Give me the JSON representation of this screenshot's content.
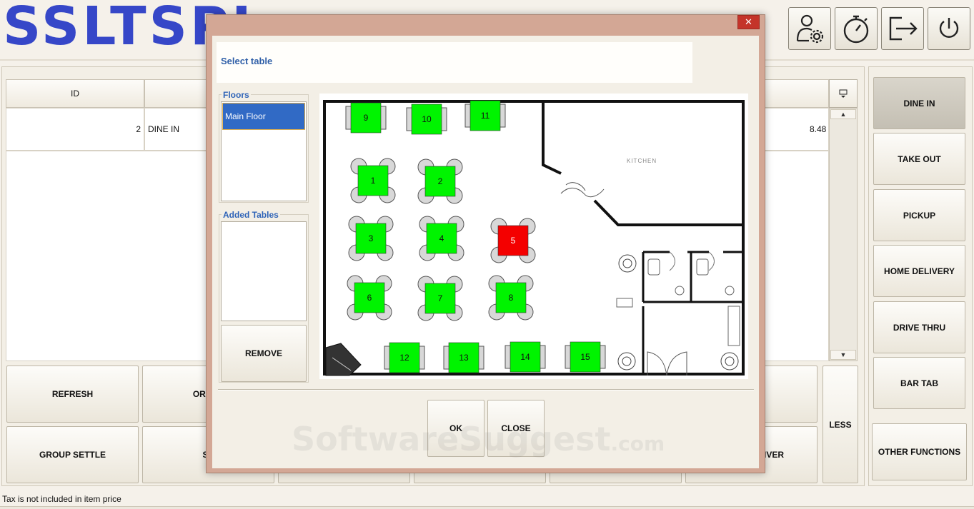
{
  "header": {
    "logo_text": "SSLTSPI",
    "buttons": [
      {
        "name": "user-settings-button",
        "icon": "user-gear-icon"
      },
      {
        "name": "timer-button",
        "icon": "stopwatch-icon"
      },
      {
        "name": "logout-button",
        "icon": "exit-arrow-icon"
      },
      {
        "name": "power-button",
        "icon": "power-icon"
      }
    ]
  },
  "grid": {
    "headers": [
      "ID"
    ],
    "rows": [
      {
        "id": "2",
        "type": "DINE IN",
        "amount": "8.48"
      }
    ]
  },
  "bottom_buttons": {
    "row1": [
      "REFRESH",
      "ORDER"
    ],
    "row2": [
      "GROUP SETTLE",
      "SP"
    ],
    "partial_right": "IVER",
    "less": "LESS"
  },
  "order_types": [
    "DINE IN",
    "TAKE OUT",
    "PICKUP",
    "HOME DELIVERY",
    "DRIVE THRU",
    "BAR TAB"
  ],
  "other_functions": "OTHER FUNCTIONS",
  "status_text": "Tax is not included in item price",
  "modal": {
    "title": "Select table",
    "close_glyph": "✕",
    "floors_label": "Floors",
    "floors": [
      "Main Floor"
    ],
    "added_tables_label": "Added Tables",
    "remove_label": "REMOVE",
    "ok_label": "OK",
    "close_label": "CLOSE",
    "kitchen_label": "KITCHEN",
    "tables": [
      {
        "n": "9",
        "status": "available"
      },
      {
        "n": "10",
        "status": "available"
      },
      {
        "n": "11",
        "status": "available"
      },
      {
        "n": "1",
        "status": "available"
      },
      {
        "n": "2",
        "status": "available"
      },
      {
        "n": "3",
        "status": "available"
      },
      {
        "n": "4",
        "status": "available"
      },
      {
        "n": "5",
        "status": "occupied"
      },
      {
        "n": "6",
        "status": "available"
      },
      {
        "n": "7",
        "status": "available"
      },
      {
        "n": "8",
        "status": "available"
      },
      {
        "n": "12",
        "status": "available"
      },
      {
        "n": "13",
        "status": "available"
      },
      {
        "n": "14",
        "status": "available"
      },
      {
        "n": "15",
        "status": "available"
      }
    ],
    "colors": {
      "available": "#00f400",
      "occupied": "#f40000"
    }
  },
  "watermark": {
    "main": "SoftwareSuggest",
    "suffix": ".com"
  }
}
